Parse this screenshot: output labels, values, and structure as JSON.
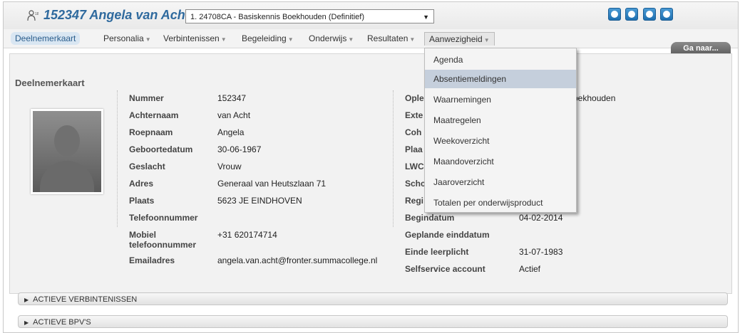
{
  "header": {
    "student_title": "152347 Angela van Acht",
    "program_select": "1. 24708CA - Basiskennis Boekhouden (Definitief)"
  },
  "menu": [
    {
      "label": "Deelnemerkaart",
      "caret": ""
    },
    {
      "label": "Personalia",
      "caret": "▼"
    },
    {
      "label": "Verbintenissen",
      "caret": "▼"
    },
    {
      "label": "Begeleiding",
      "caret": "▼"
    },
    {
      "label": "Onderwijs",
      "caret": "▼"
    },
    {
      "label": "Resultaten",
      "caret": "▼"
    },
    {
      "label": "Aanwezigheid",
      "caret": "▼"
    }
  ],
  "ga_naar": "Ga naar...",
  "section_title": "Deelnemerkaart",
  "left_fields": [
    {
      "label": "Nummer",
      "value": "152347"
    },
    {
      "label": "Achternaam",
      "value": "van Acht"
    },
    {
      "label": "Roepnaam",
      "value": "Angela"
    },
    {
      "label": "Geboortedatum",
      "value": "30-06-1967"
    },
    {
      "label": "Geslacht",
      "value": "Vrouw"
    },
    {
      "label": "Adres",
      "value": "Generaal van Heutszlaan 71"
    },
    {
      "label": "Plaats",
      "value": "5623 JE  EINDHOVEN"
    },
    {
      "label": "Telefoonnummer",
      "value": ""
    },
    {
      "label": "Mobiel telefoonnummer",
      "value": "+31 620174714"
    },
    {
      "label": "Emailadres",
      "value": "angela.van.acht@fronter.summacollege.nl"
    }
  ],
  "right_fields": [
    {
      "label": "Ople",
      "value": "oekhouden"
    },
    {
      "label": "Exte",
      "value": ""
    },
    {
      "label": "Coh",
      "value": ""
    },
    {
      "label": "Plaa",
      "value": ""
    },
    {
      "label": "LWC",
      "value": ""
    },
    {
      "label": "Schc",
      "value": ""
    },
    {
      "label": "Regi",
      "value": ""
    },
    {
      "label": "Begindatum",
      "value": "04-02-2014"
    },
    {
      "label": "Geplande einddatum",
      "value": ""
    },
    {
      "label": "Einde leerplicht",
      "value": "31-07-1983"
    },
    {
      "label": "Selfservice account",
      "value": "Actief"
    }
  ],
  "dropdown": [
    "Agenda",
    "Absentiemeldingen",
    "Waarnemingen",
    "Maatregelen",
    "Weekoverzicht",
    "Maandoverzicht",
    "Jaaroverzicht",
    "Totalen per onderwijsproduct"
  ],
  "collapse": [
    "ACTIEVE VERBINTENISSEN",
    "ACTIEVE BPV'S"
  ],
  "colors": {
    "accent": "#2f6a9e",
    "nav_button": "#1e6fb0",
    "highlight": "#c5cfdc"
  }
}
